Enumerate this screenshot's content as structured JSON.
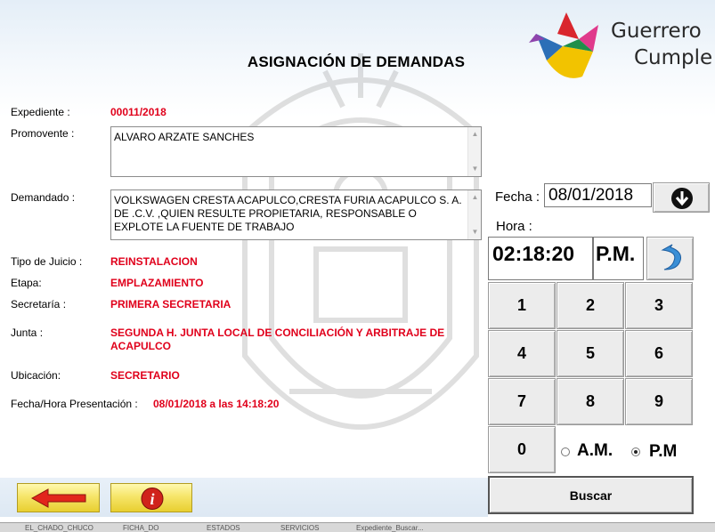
{
  "title": "ASIGNACIÓN DE DEMANDAS",
  "logo": {
    "line1": "Guerrero",
    "line2": "Cumple"
  },
  "form": {
    "expediente_label": "Expediente :",
    "expediente_value": "00011/2018",
    "promovente_label": "Promovente :",
    "promovente_value": "ALVARO ARZATE SANCHES",
    "demandado_label": "Demandado :",
    "demandado_value": "VOLKSWAGEN CRESTA ACAPULCO,CRESTA FURIA ACAPULCO S. A. DE .C.V. ,QUIEN RESULTE PROPIETARIA, RESPONSABLE O EXPLOTE LA FUENTE DE TRABAJO",
    "tipo_label": "Tipo de Juicio :",
    "tipo_value": "REINSTALACION",
    "etapa_label": "Etapa:",
    "etapa_value": "EMPLAZAMIENTO",
    "secretaria_label": "Secretaría :",
    "secretaria_value": "PRIMERA SECRETARIA",
    "junta_label": "Junta :",
    "junta_value": "SEGUNDA H. JUNTA LOCAL DE CONCILIACIÓN Y ARBITRAJE DE ACAPULCO",
    "ubicacion_label": "Ubicación:",
    "ubicacion_value": "SECRETARIO",
    "fecha_hora_label": "Fecha/Hora Presentación :",
    "fecha_hora_value": "08/01/2018 a las 14:18:20"
  },
  "panel": {
    "fecha_label": "Fecha :",
    "fecha_value": "08/01/2018",
    "hora_label": "Hora :",
    "time_value": "02:18:20",
    "ampm_value": "P.M.",
    "keys": [
      "1",
      "2",
      "3",
      "4",
      "5",
      "6",
      "7",
      "8",
      "9",
      "0"
    ],
    "am_label": "A.M.",
    "pm_label": "P.M",
    "selected_period": "P.M",
    "buscar_label": "Buscar"
  },
  "taskbar": [
    "EL_CHADO_CHUCO",
    "FICHA_DO",
    "ESTADOS",
    "SERVICIOS",
    "Expediente_Buscar..."
  ]
}
